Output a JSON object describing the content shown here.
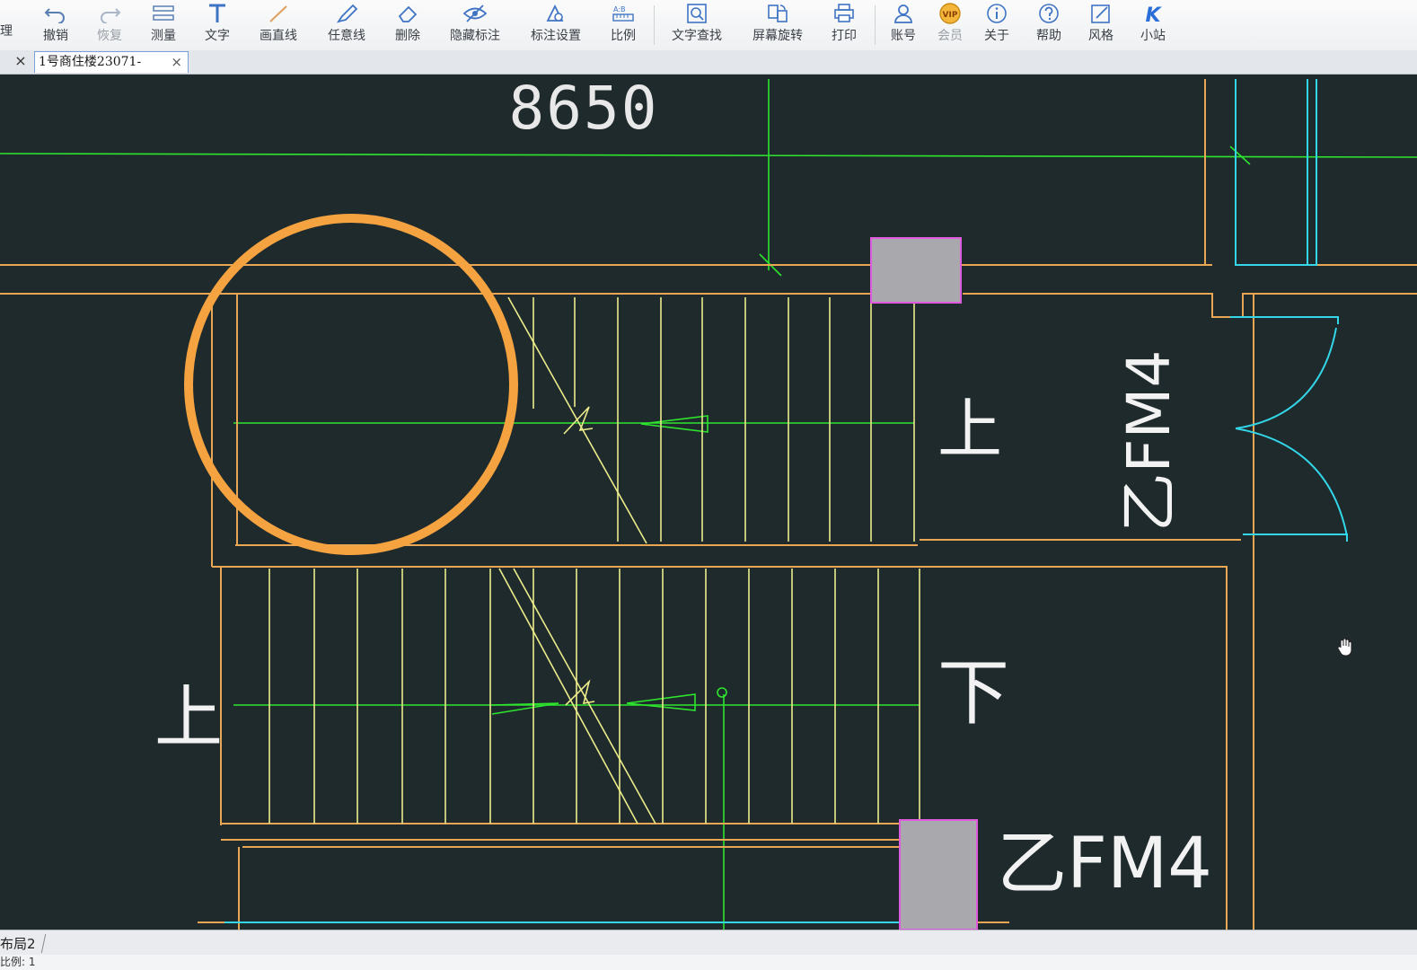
{
  "toolbar": {
    "left_cut_label": "理",
    "items": [
      {
        "label": "撤销",
        "icon": "undo-icon"
      },
      {
        "label": "恢复",
        "icon": "redo-icon"
      },
      {
        "label": "测量",
        "icon": "measure-icon"
      },
      {
        "label": "文字",
        "icon": "text-icon"
      },
      {
        "label": "画直线",
        "icon": "line-icon"
      },
      {
        "label": "任意线",
        "icon": "pen-icon"
      },
      {
        "label": "删除",
        "icon": "eraser-icon"
      },
      {
        "label": "隐藏标注",
        "icon": "hide-annotation-icon"
      },
      {
        "label": "标注设置",
        "icon": "annotation-settings-icon"
      },
      {
        "label": "比例",
        "icon": "scale-icon"
      },
      {
        "label": "文字查找",
        "icon": "text-search-icon"
      },
      {
        "label": "屏幕旋转",
        "icon": "rotate-screen-icon"
      },
      {
        "label": "打印",
        "icon": "print-icon"
      },
      {
        "label": "账号",
        "icon": "account-icon"
      },
      {
        "label": "会员",
        "icon": "vip-icon",
        "badge": "VIP"
      },
      {
        "label": "关于",
        "icon": "info-icon"
      },
      {
        "label": "帮助",
        "icon": "help-icon"
      },
      {
        "label": "风格",
        "icon": "style-icon"
      },
      {
        "label": "小站",
        "icon": "k-station-icon",
        "badge": "K"
      }
    ]
  },
  "tabs": {
    "lone_close": "×",
    "active_tab": {
      "label": "1号商住楼23071-",
      "close": "×"
    }
  },
  "drawing": {
    "dimension_text": "8650",
    "label_up_right": "上",
    "label_up_left": "上",
    "label_down": "下",
    "door_label_top": "乙FM4",
    "door_label_bottom": "乙FM4",
    "highlight_color": "#f5a340"
  },
  "bottom": {
    "layout_tab": "布局2",
    "status_text": "比例: 1"
  },
  "colors": {
    "background": "#1f2a2d",
    "wall": "#e9a755",
    "stair": "#ecec8a",
    "axis": "#2ee52e",
    "door": "#33d6e8",
    "column_fill": "#a9a9ad",
    "column_border": "#e05ae0",
    "annotation": "#ffffff"
  }
}
